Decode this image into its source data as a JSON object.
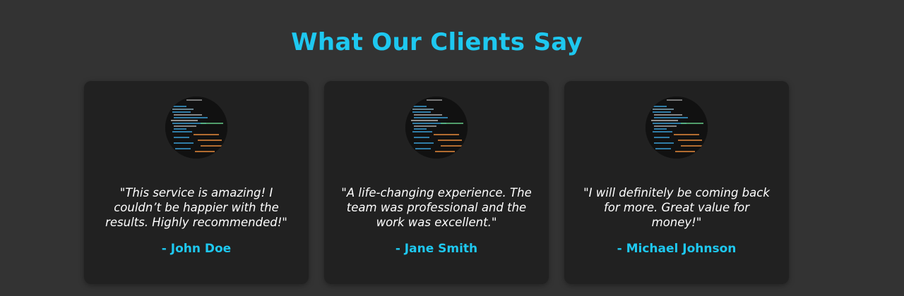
{
  "section": {
    "title": "What Our Clients Say",
    "accent_color": "#1ec8f0"
  },
  "testimonials": [
    {
      "avatar": "code-screen-avatar",
      "quote": "\"This service is amazing! I couldn’t be happier with the results. Highly recommended!\"",
      "author": "- John Doe"
    },
    {
      "avatar": "code-screen-avatar",
      "quote": "\"A life-changing experience. The team was professional and the work was excellent.\"",
      "author": "- Jane Smith"
    },
    {
      "avatar": "code-screen-avatar",
      "quote": "\"I will definitely be coming back for more. Great value for money!\"",
      "author": "- Michael Johnson"
    }
  ]
}
